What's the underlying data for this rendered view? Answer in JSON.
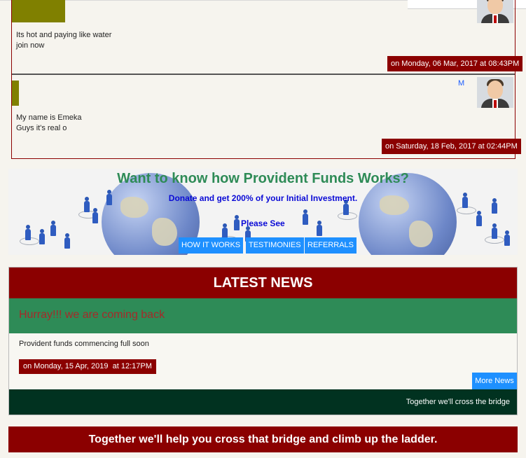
{
  "comments": [
    {
      "lines": [
        "Its hot and paying like water",
        "join now"
      ],
      "date": "on Monday, 06 Mar, 2017 at 08:43PM"
    },
    {
      "initial": "M",
      "lines": [
        "My name is Emeka",
        "Guys it's real o"
      ],
      "date": "on Saturday, 18 Feb, 2017 at 02:44PM"
    }
  ],
  "banner": {
    "title": "Want to know how Provident Funds Works?",
    "subtitle": "Donate and get 200% of your Initial Investment.",
    "please_see": "Please See",
    "buttons": [
      "HOW IT WORKS",
      "TESTIMONIES",
      "REFERRALS"
    ],
    "colors": {
      "title": "#2e8b57",
      "text": "#0a0ad6",
      "button": "#1e90ff"
    }
  },
  "news": {
    "heading": "LATEST NEWS",
    "headline": "Hurray!!! we are coming back",
    "body": "Provident funds commencing full soon",
    "date": "on Monday, 15 Apr, 2019  at 12:17PM",
    "more_label": "More News",
    "footer": "Together we'll cross the bridge"
  },
  "footer": {
    "text": "Together we'll help you cross that bridge and climb up the ladder."
  },
  "colors": {
    "primary": "#8b0000",
    "green": "#2e8b57",
    "dark_green": "#013220",
    "accent": "#1e90ff",
    "olive": "#808000"
  },
  "icons": [
    "user-avatar-icon"
  ]
}
